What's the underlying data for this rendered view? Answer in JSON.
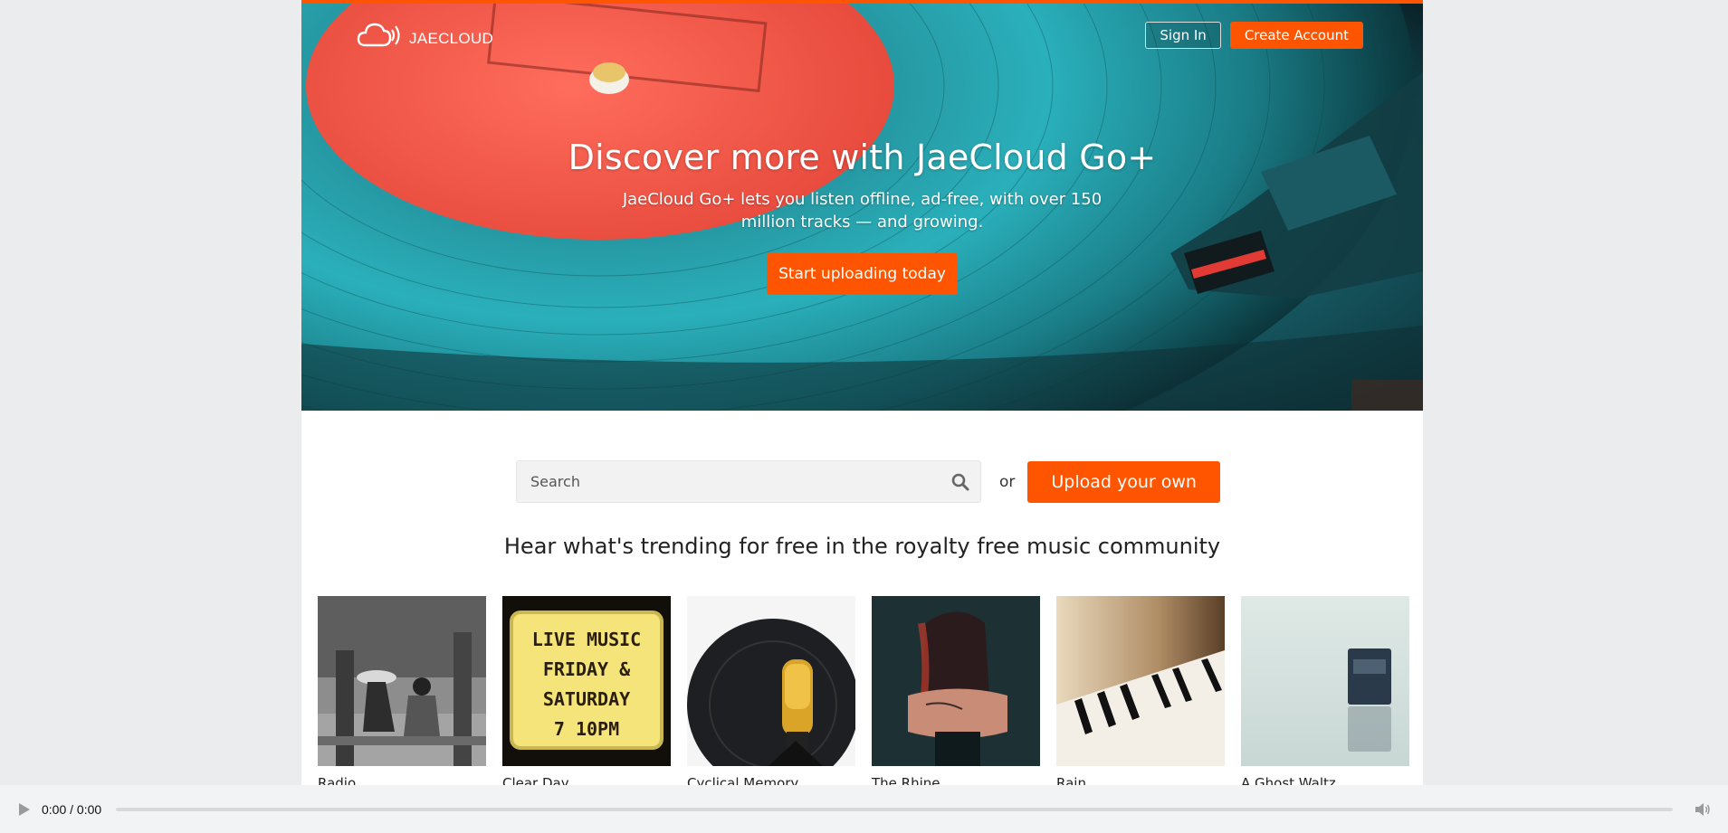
{
  "brand": {
    "name": "JAECLOUD",
    "accent": "#ff5500",
    "logo_icon": "cloud-signal-icon"
  },
  "header": {
    "sign_in_label": "Sign In",
    "create_account_label": "Create Account"
  },
  "hero": {
    "title": "Discover more with JaeCloud Go+",
    "subtitle": "JaeCloud Go+ lets you listen offline, ad-free, with over 150 million tracks — and growing.",
    "cta_label": "Start uploading today"
  },
  "search": {
    "placeholder": "Search",
    "icon": "search-icon",
    "or_text": "or",
    "upload_label": "Upload your own"
  },
  "trending": {
    "heading": "Hear what's trending for free in the royalty free music community",
    "tracks": [
      {
        "title": "Radio"
      },
      {
        "title": "Clear Day"
      },
      {
        "title": "Cyclical Memory"
      },
      {
        "title": "The Rhine"
      },
      {
        "title": "Rain"
      },
      {
        "title": "A Ghost Waltz"
      }
    ]
  },
  "player": {
    "time": "0:00 / 0:00",
    "progress": 0,
    "play_icon": "play-icon",
    "volume_icon": "volume-icon"
  }
}
